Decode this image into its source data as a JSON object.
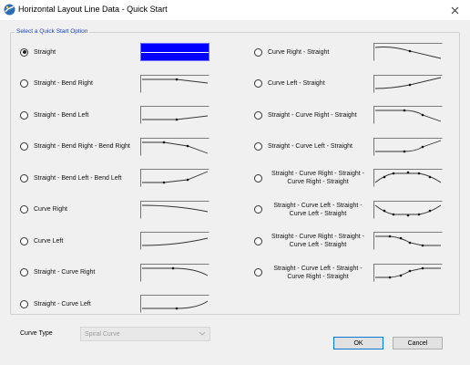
{
  "window": {
    "title": "Horizontal Layout Line Data - Quick Start"
  },
  "group": {
    "legend": "Select a Quick Start Option"
  },
  "options_left": [
    {
      "lines": [
        "Straight"
      ],
      "selected": true,
      "preview": "selected"
    },
    {
      "lines": [
        "Straight - Bend Right"
      ],
      "selected": false,
      "preview": "bend-right"
    },
    {
      "lines": [
        "Straight - Bend Left"
      ],
      "selected": false,
      "preview": "bend-left"
    },
    {
      "lines": [
        "Straight - Bend Right - Bend Right"
      ],
      "selected": false,
      "preview": "bend-right-bend-right"
    },
    {
      "lines": [
        "Straight - Bend Left - Bend Left"
      ],
      "selected": false,
      "preview": "bend-left-bend-left"
    },
    {
      "lines": [
        "Curve Right"
      ],
      "selected": false,
      "preview": "curve-right"
    },
    {
      "lines": [
        "Curve Left"
      ],
      "selected": false,
      "preview": "curve-left"
    },
    {
      "lines": [
        "Straight - Curve Right"
      ],
      "selected": false,
      "preview": "straight-curve-right"
    },
    {
      "lines": [
        "Straight - Curve Left"
      ],
      "selected": false,
      "preview": "straight-curve-left"
    }
  ],
  "options_right": [
    {
      "lines": [
        "Curve Right - Straight"
      ],
      "selected": false,
      "preview": "curve-right-straight"
    },
    {
      "lines": [
        "Curve Left - Straight"
      ],
      "selected": false,
      "preview": "curve-left-straight"
    },
    {
      "lines": [
        "Straight - Curve Right - Straight"
      ],
      "selected": false,
      "preview": "scr-s"
    },
    {
      "lines": [
        "Straight - Curve Left - Straight"
      ],
      "selected": false,
      "preview": "scl-s"
    },
    {
      "lines": [
        "Straight - Curve Right - Straight -",
        "Curve Right - Straight"
      ],
      "selected": false,
      "preview": "scrs-crs"
    },
    {
      "lines": [
        "Straight - Curve Left - Straight -",
        "Curve Left - Straight"
      ],
      "selected": false,
      "preview": "scls-cls"
    },
    {
      "lines": [
        "Straight - Curve Right - Straight -",
        "Curve Left - Straight"
      ],
      "selected": false,
      "preview": "scrs-cls"
    },
    {
      "lines": [
        "Straight - Curve Left - Straight -",
        "Curve Right - Straight"
      ],
      "selected": false,
      "preview": "scls-crs"
    }
  ],
  "curve_type": {
    "label": "Curve Type",
    "value": "Spiral Curve",
    "enabled": false
  },
  "buttons": {
    "ok": "OK",
    "cancel": "Cancel"
  },
  "icons": {
    "app": "road-app-icon",
    "close": "close-icon",
    "combo_arrow": "chevron-down-icon"
  },
  "colors": {
    "legend_text": "#1a3fb8",
    "selected_preview": "#0000ff",
    "ok_border": "#0078d7"
  }
}
